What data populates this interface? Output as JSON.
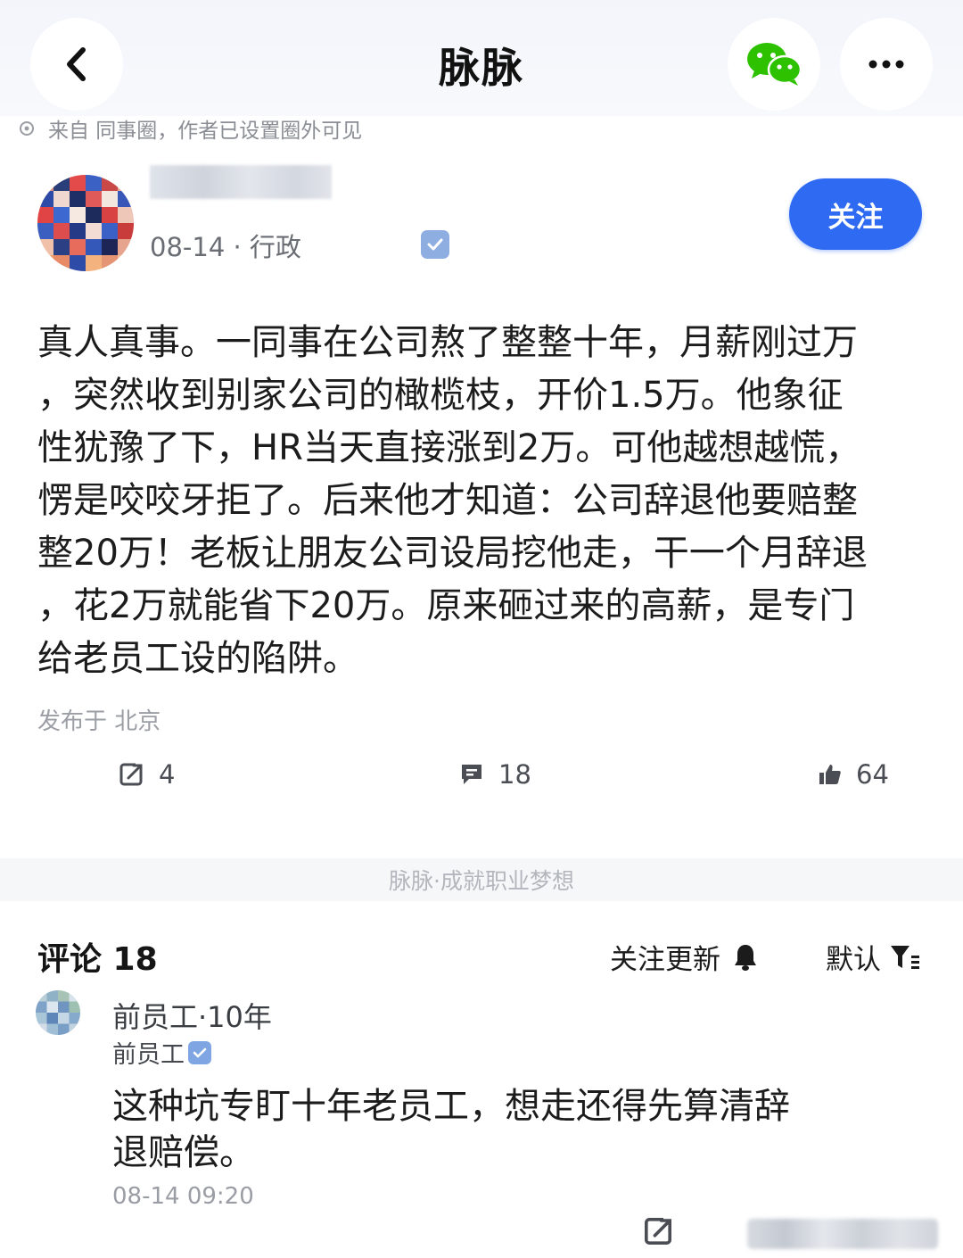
{
  "header": {
    "title": "脉脉",
    "back_icon": "chevron-left-icon",
    "share_icon": "wechat-icon",
    "more_icon": "more-dots-icon"
  },
  "source": {
    "text": "来自 同事圈，作者已设置圈外可见"
  },
  "post": {
    "meta": "08-14 · 行政",
    "follow_label": "关注",
    "body": "真人真事。一同事在公司熬了整整十年，月薪刚过万\n，突然收到别家公司的橄榄枝，开价1.5万。他象征\n性犹豫了下，HR当天直接涨到2万。可他越想越慌，\n愣是咬咬牙拒了。后来他才知道：公司辞退他要赔整\n整20万！老板让朋友公司设局挖他走，干一个月辞退\n，花2万就能省下20万。原来砸过来的高薪，是专门\n给老员工设的陷阱。",
    "location": "发布于 北京",
    "share_count": "4",
    "comment_count": "18",
    "like_count": "64"
  },
  "footer_band": {
    "text": "脉脉·成就职业梦想"
  },
  "comments": {
    "title": "评论 18",
    "subscribe_label": "关注更新",
    "sort_label": "默认",
    "items": [
      {
        "name": "前员工·10年",
        "role": "前员工",
        "text": "这种坑专盯十年老员工，想走还得先算清辞\n退赔偿。",
        "time": "08-14 09:20"
      }
    ]
  },
  "colors": {
    "accent": "#2f6bf2",
    "wechat_green": "#2dc100",
    "muted_text": "#9b9ea4"
  }
}
